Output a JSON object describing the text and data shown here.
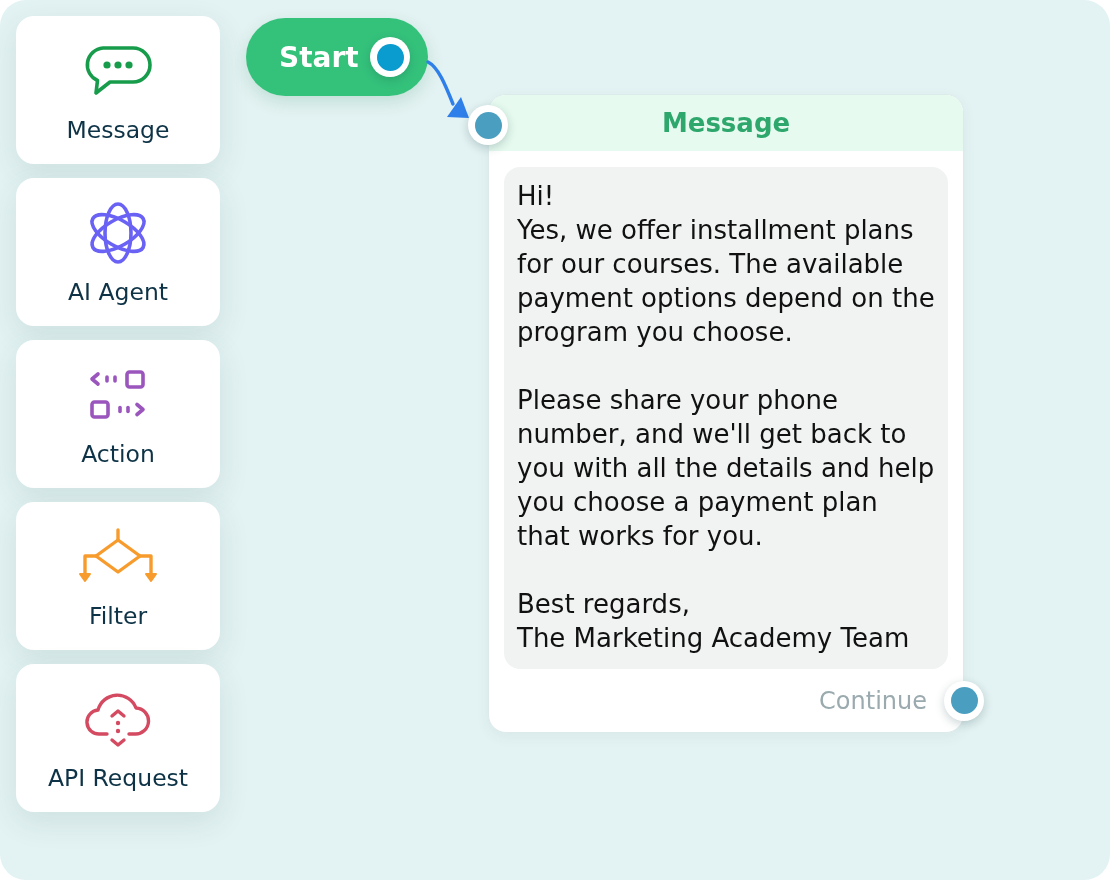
{
  "sidebar": {
    "items": [
      {
        "kind": "message",
        "label": "Message"
      },
      {
        "kind": "ai_agent",
        "label": "AI Agent"
      },
      {
        "kind": "action",
        "label": "Action"
      },
      {
        "kind": "filter",
        "label": "Filter"
      },
      {
        "kind": "api_request",
        "label": "API Request"
      }
    ]
  },
  "canvas": {
    "start_node": {
      "label": "Start"
    },
    "message_node": {
      "title": "Message",
      "text": "Hi!\nYes, we offer installment plans for our courses. The available payment options depend on the program you choose.\n\nPlease share your phone number, and we'll get back to you with all the details and help you choose a payment plan that works for you.\n\nBest regards,\nThe Marketing Academy Team",
      "output_label": "Continue"
    }
  }
}
